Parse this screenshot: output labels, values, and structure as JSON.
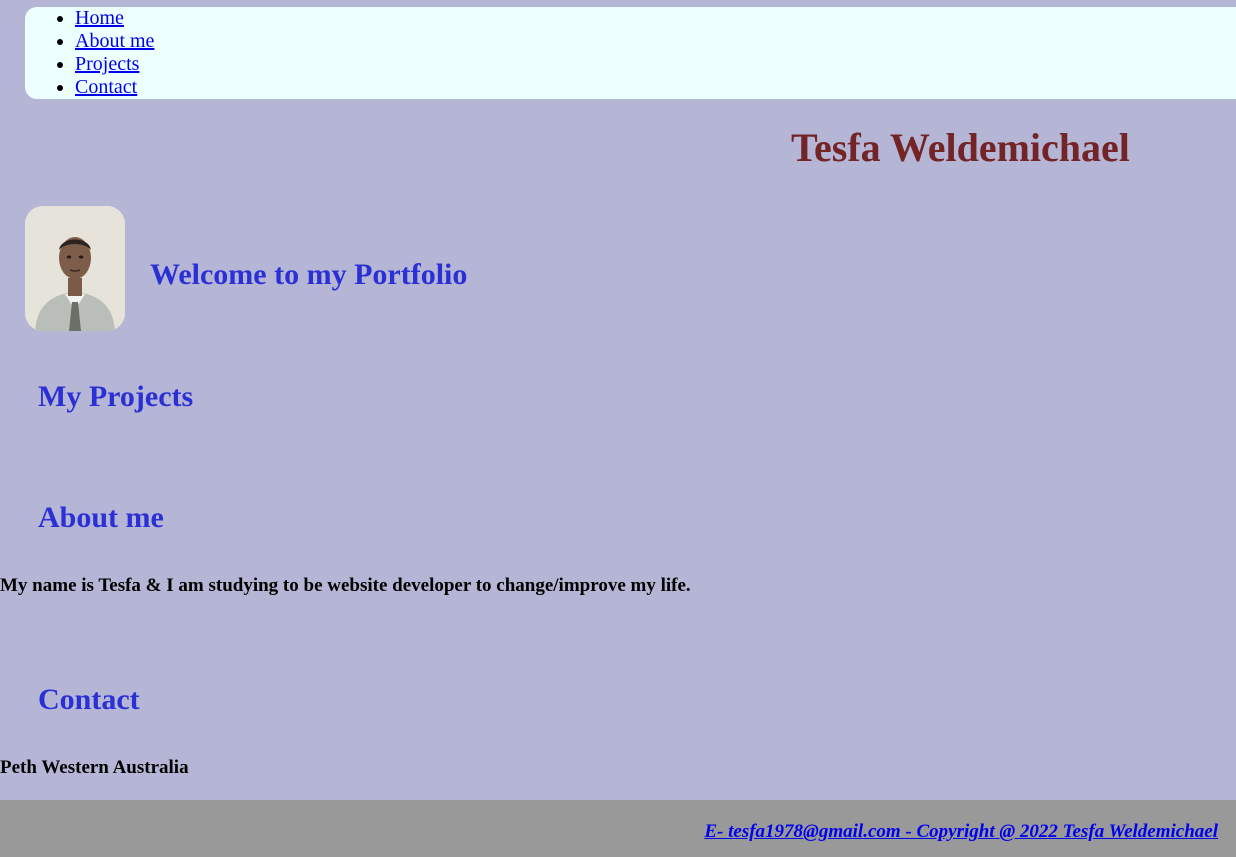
{
  "nav": {
    "items": [
      {
        "label": "Home"
      },
      {
        "label": "About me"
      },
      {
        "label": "Projects"
      },
      {
        "label": "Contact"
      }
    ]
  },
  "header": {
    "title": "Tesfa Weldemichael"
  },
  "hero": {
    "welcome": "Welcome to my Portfolio"
  },
  "projects": {
    "heading": "My Projects"
  },
  "about": {
    "heading": "About me",
    "text": "My name is Tesfa & I am studying to be website developer to change/improve my life."
  },
  "contact": {
    "heading": "Contact",
    "location": "Peth Western Australia"
  },
  "footer": {
    "text": "E- tesfa1978@gmail.com - Copyright @ 2022 Tesfa Weldemichael"
  }
}
